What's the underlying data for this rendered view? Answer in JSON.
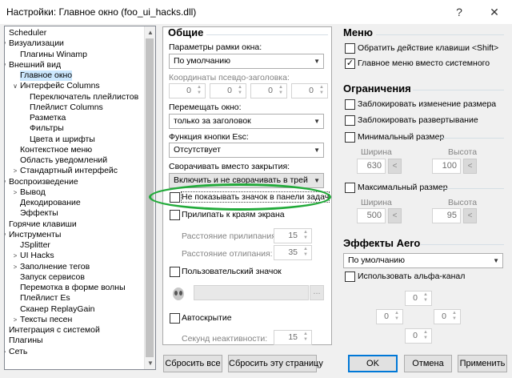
{
  "window": {
    "title": "Настройки: Главное окно (foo_ui_hacks.dll)",
    "help_glyph": "?",
    "close_glyph": "✕"
  },
  "tree": {
    "items": [
      {
        "label": "Scheduler",
        "level": 0,
        "expander": ""
      },
      {
        "label": "Визуализации",
        "level": 0,
        "expander": "∨"
      },
      {
        "label": "Плагины Winamp",
        "level": 1,
        "expander": ""
      },
      {
        "label": "Внешний вид",
        "level": 0,
        "expander": "∨"
      },
      {
        "label": "Главное окно",
        "level": 1,
        "expander": "",
        "selected": true
      },
      {
        "label": "Интерфейс Columns",
        "level": 1,
        "expander": "∨"
      },
      {
        "label": "Переключатель плейлистов",
        "level": 2,
        "expander": ""
      },
      {
        "label": "Плейлист Columns",
        "level": 2,
        "expander": ""
      },
      {
        "label": "Разметка",
        "level": 2,
        "expander": ""
      },
      {
        "label": "Фильтры",
        "level": 2,
        "expander": ""
      },
      {
        "label": "Цвета и шрифты",
        "level": 2,
        "expander": ""
      },
      {
        "label": "Контекстное меню",
        "level": 1,
        "expander": ""
      },
      {
        "label": "Область уведомлений",
        "level": 1,
        "expander": ""
      },
      {
        "label": "Стандартный интерфейс",
        "level": 1,
        "expander": ">"
      },
      {
        "label": "Воспроизведение",
        "level": 0,
        "expander": "∨"
      },
      {
        "label": "Вывод",
        "level": 1,
        "expander": ">"
      },
      {
        "label": "Декодирование",
        "level": 1,
        "expander": ""
      },
      {
        "label": "Эффекты",
        "level": 1,
        "expander": ""
      },
      {
        "label": "Горячие клавиши",
        "level": 0,
        "expander": ""
      },
      {
        "label": "Инструменты",
        "level": 0,
        "expander": "∨"
      },
      {
        "label": "JSplitter",
        "level": 1,
        "expander": ""
      },
      {
        "label": "UI Hacks",
        "level": 1,
        "expander": ">"
      },
      {
        "label": "Заполнение тегов",
        "level": 1,
        "expander": ">"
      },
      {
        "label": "Запуск сервисов",
        "level": 1,
        "expander": ""
      },
      {
        "label": "Перемотка в форме волны",
        "level": 1,
        "expander": ""
      },
      {
        "label": "Плейлист Es",
        "level": 1,
        "expander": ""
      },
      {
        "label": "Сканер ReplayGain",
        "level": 1,
        "expander": ""
      },
      {
        "label": "Тексты песен",
        "level": 1,
        "expander": ">"
      },
      {
        "label": "Интеграция с системой",
        "level": 0,
        "expander": ""
      },
      {
        "label": "Плагины",
        "level": 0,
        "expander": ""
      },
      {
        "label": "Сеть",
        "level": 0,
        "expander": ">"
      }
    ]
  },
  "general": {
    "title": "Общие",
    "frame_label": "Параметры рамки окна:",
    "frame_value": "По умолчанию",
    "pseudo_label": "Координаты псевдо-заголовка:",
    "pseudo_values": [
      "0",
      "0",
      "0",
      "0"
    ],
    "move_label": "Перемещать окно:",
    "move_value": "только за заголовок",
    "esc_label": "Функция кнопки Esc:",
    "esc_value": "Отсутствует",
    "close_label": "Сворачивать вместо закрытия:",
    "close_value": "Включить и не сворачивать в трей",
    "hide_icon_label": "Не показывать значок в панели задач",
    "hide_icon_checked": false,
    "snap_label": "Прилипать к краям экрана",
    "snap_checked": false,
    "snap_dist_label": "Расстояние прилипания:",
    "snap_dist_value": "15",
    "unsnap_dist_label": "Расстояние отлипания:",
    "unsnap_dist_value": "35",
    "custom_icon_label": "Пользовательский значок",
    "custom_icon_checked": false,
    "browse_label": "...",
    "autohide_label": "Автоскрытие",
    "autohide_checked": false,
    "inactive_label": "Секунд неактивности:",
    "inactive_value": "15"
  },
  "menu": {
    "title": "Меню",
    "invert_shift_label": "Обратить действие клавиши <Shift>",
    "invert_shift_checked": false,
    "main_menu_label": "Главное меню вместо системного",
    "main_menu_checked": true
  },
  "limits": {
    "title": "Ограничения",
    "lock_resize_label": "Заблокировать изменение размера",
    "lock_maximize_label": "Заблокировать развертывание",
    "min_size_label": "Минимальный размер",
    "max_size_label": "Максимальный размер",
    "width_label": "Ширина",
    "height_label": "Высота",
    "min_width": "630",
    "min_height": "100",
    "max_width": "500",
    "max_height": "95",
    "pick_glyph": "<"
  },
  "aero": {
    "title": "Эффекты Aero",
    "mode_value": "По умолчанию",
    "alpha_label": "Использовать альфа-канал",
    "alpha_checked": false,
    "margins": [
      "0",
      "0",
      "0",
      "0"
    ]
  },
  "buttons": {
    "reset_all": "Сбросить все",
    "reset_page": "Сбросить эту страницу",
    "ok": "OK",
    "cancel": "Отмена",
    "apply": "Применить"
  },
  "colors": {
    "highlight": "#22aa3a",
    "selection": "#cce8ff",
    "focus": "#0078d7"
  }
}
